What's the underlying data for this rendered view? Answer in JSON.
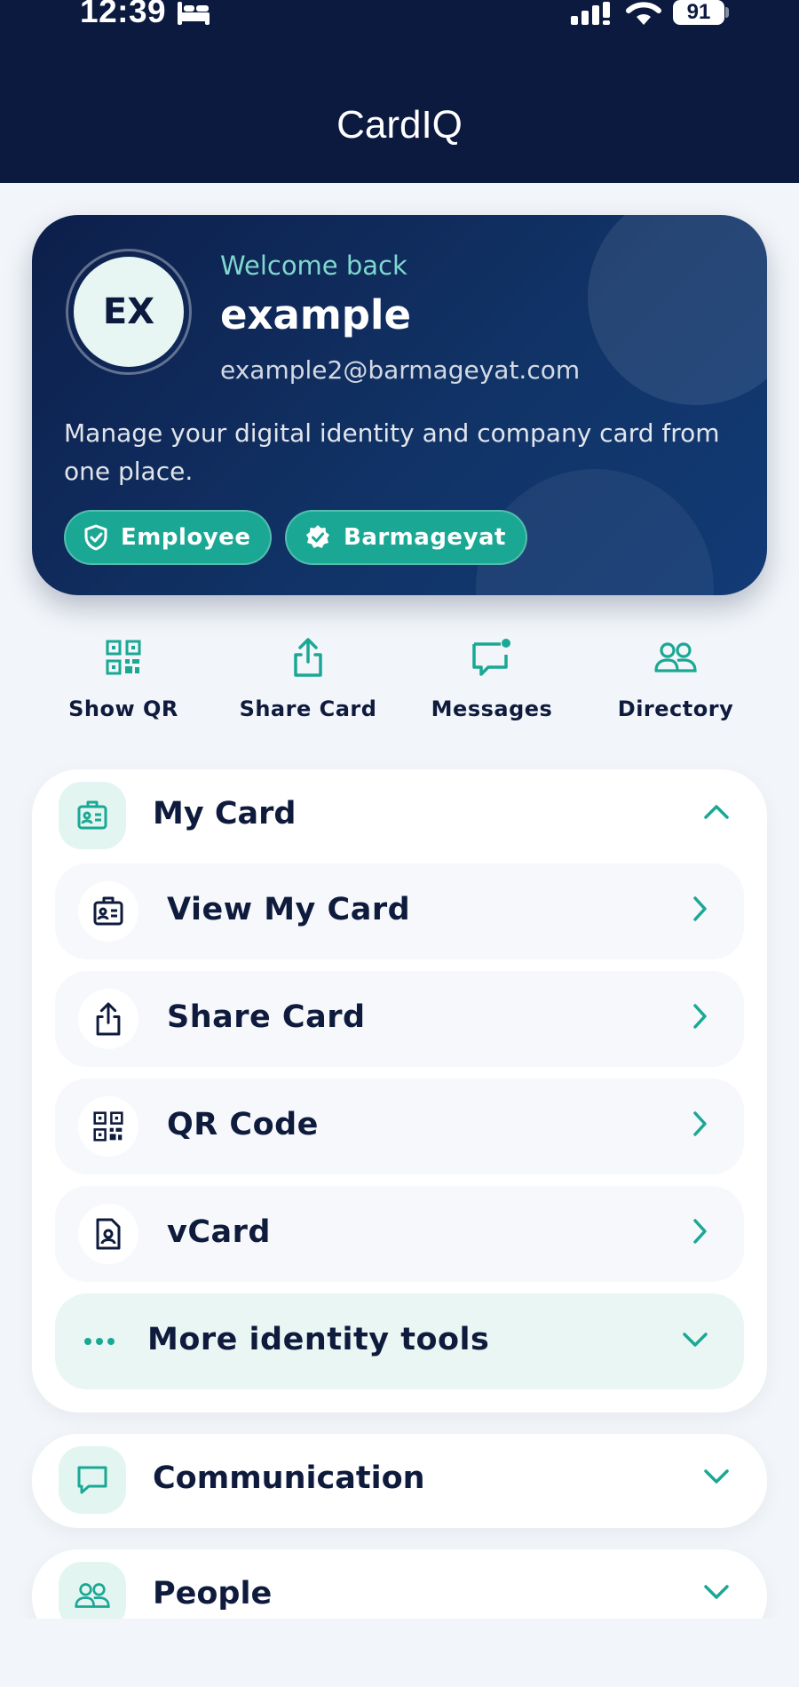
{
  "status_bar": {
    "time": "12:39",
    "battery": "91"
  },
  "app": {
    "title": "CardIQ"
  },
  "profile": {
    "initials": "EX",
    "welcome": "Welcome back",
    "name": "example",
    "email": "example2@barmageyat.com",
    "description": "Manage your digital identity and company card from one place.",
    "badges": [
      {
        "label": "Employee",
        "icon": "shield-check-icon"
      },
      {
        "label": "Barmageyat",
        "icon": "verified-badge-icon"
      }
    ]
  },
  "quick_actions": [
    {
      "label": "Show QR",
      "icon": "qr-code-icon"
    },
    {
      "label": "Share Card",
      "icon": "share-icon"
    },
    {
      "label": "Messages",
      "icon": "message-icon"
    },
    {
      "label": "Directory",
      "icon": "people-icon"
    }
  ],
  "sections": {
    "my_card": {
      "title": "My Card",
      "expanded": true,
      "items": [
        {
          "label": "View My Card",
          "icon": "id-card-icon"
        },
        {
          "label": "Share Card",
          "icon": "share-icon"
        },
        {
          "label": "QR Code",
          "icon": "qr-code-icon"
        },
        {
          "label": "vCard",
          "icon": "contact-file-icon"
        }
      ],
      "more": {
        "label": "More identity tools",
        "icon": "more-dots-icon"
      }
    },
    "communication": {
      "title": "Communication",
      "expanded": false
    },
    "people": {
      "title": "People",
      "expanded": false
    }
  },
  "colors": {
    "navy": "#0c1a3f",
    "teal": "#1aa894",
    "teal_light": "#e3f5f1",
    "background": "#f2f5f9"
  }
}
